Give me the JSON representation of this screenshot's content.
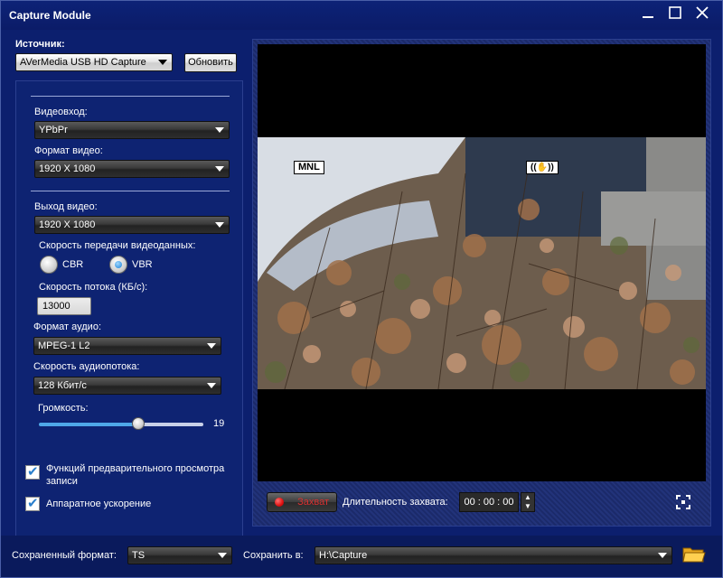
{
  "window": {
    "title": "Capture Module"
  },
  "source": {
    "label": "Источник:",
    "device": "AVerMedia USB HD Capture",
    "refresh_label": "Обновить"
  },
  "video_in": {
    "label": "Видеовход:",
    "value": "YPbPr",
    "format_label": "Формат видео:",
    "format_value": "1920 X 1080"
  },
  "video_out": {
    "label": "Выход видео:",
    "value": "1920 X 1080",
    "rate_label": "Скорость передачи видеоданных:",
    "cbr_label": "CBR",
    "vbr_label": "VBR",
    "bitrate_label": "Скорость потока (КБ/с):",
    "bitrate_value": "13000"
  },
  "audio": {
    "format_label": "Формат аудио:",
    "format_value": "MPEG-1 L2",
    "rate_label": "Скорость аудиопотока:",
    "rate_value": "128 Кбит/с",
    "volume_label": "Громкость:",
    "volume_value": "19"
  },
  "options": {
    "preview_label_1": "Функций предварительного просмотра",
    "preview_label_2": "записи",
    "hw_accel_label": "Аппаратное ускорение"
  },
  "preview": {
    "osd_left": "MNL"
  },
  "capture": {
    "button_label": "Захват",
    "duration_label": "Длительность захвата:",
    "duration_value": "00 : 00 : 00"
  },
  "bottom": {
    "format_label": "Сохраненный формат:",
    "format_value": "TS",
    "save_label": "Сохранить в:",
    "save_path": "H:\\Capture"
  }
}
